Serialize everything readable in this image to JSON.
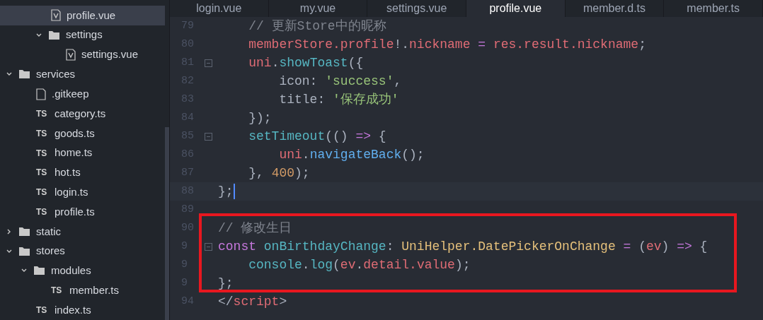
{
  "sidebar": {
    "tree": [
      {
        "children": [
          {
            "kind": "vue",
            "label": "profile.vue",
            "selected": true
          },
          {
            "kind": "folder",
            "label": "settings",
            "expanded": true,
            "selected": false,
            "children": [
              {
                "kind": "vue",
                "label": "settings.vue",
                "selected": false
              }
            ]
          }
        ]
      },
      {
        "kind": "folder",
        "label": "services",
        "expanded": true,
        "selected": false,
        "children": [
          {
            "kind": "blank",
            "label": ".gitkeep",
            "selected": false
          },
          {
            "kind": "ts",
            "icon": "TS",
            "label": "category.ts",
            "selected": false
          },
          {
            "kind": "ts",
            "icon": "TS",
            "label": "goods.ts",
            "selected": false
          },
          {
            "kind": "ts",
            "icon": "TS",
            "label": "home.ts",
            "selected": false
          },
          {
            "kind": "ts",
            "icon": "TS",
            "label": "hot.ts",
            "selected": false
          },
          {
            "kind": "ts",
            "icon": "TS",
            "label": "login.ts",
            "selected": false
          },
          {
            "kind": "ts",
            "icon": "TS",
            "label": "profile.ts",
            "selected": false
          }
        ]
      },
      {
        "kind": "folder",
        "label": "static",
        "expanded": false,
        "selected": false
      },
      {
        "kind": "folder",
        "label": "stores",
        "expanded": true,
        "selected": false,
        "children": [
          {
            "kind": "folder",
            "label": "modules",
            "expanded": true,
            "selected": false,
            "children": [
              {
                "kind": "ts",
                "icon": "TS",
                "label": "member.ts",
                "selected": false
              }
            ]
          },
          {
            "kind": "ts",
            "icon": "TS",
            "label": "index.ts",
            "selected": false
          }
        ]
      }
    ]
  },
  "tabs": [
    {
      "label": "login.vue",
      "selected": false
    },
    {
      "label": "my.vue",
      "selected": false
    },
    {
      "label": "settings.vue",
      "selected": false
    },
    {
      "label": "profile.vue",
      "selected": true
    },
    {
      "label": "member.d.ts",
      "selected": false
    },
    {
      "label": "member.ts",
      "selected": false
    }
  ],
  "editor": {
    "lines": [
      {
        "number": "79",
        "fold": false,
        "current": false,
        "tokens": [
          {
            "text": "    // 更新Store中的昵称",
            "color": "#7f848e"
          }
        ]
      },
      {
        "number": "80",
        "fold": false,
        "current": false,
        "tokens": [
          {
            "text": "    memberStore.profile",
            "color": "#e06c75"
          },
          {
            "text": "!.",
            "color": "#abb2bf"
          },
          {
            "text": "nickname ",
            "color": "#e06c75"
          },
          {
            "text": "= ",
            "color": "#c678dd"
          },
          {
            "text": "res.result.nickname",
            "color": "#e06c75"
          },
          {
            "text": ";",
            "color": "#abb2bf"
          }
        ]
      },
      {
        "number": "81",
        "fold": true,
        "current": false,
        "tokens": [
          {
            "text": "    uni",
            "color": "#e06c75"
          },
          {
            "text": ".",
            "color": "#abb2bf"
          },
          {
            "text": "showToast",
            "color": "#56b6c2"
          },
          {
            "text": "({",
            "color": "#abb2bf"
          }
        ]
      },
      {
        "number": "82",
        "fold": false,
        "current": false,
        "tokens": [
          {
            "text": "        icon: ",
            "color": "#abb2bf"
          },
          {
            "text": "'success'",
            "color": "#98c379"
          },
          {
            "text": ",",
            "color": "#abb2bf"
          }
        ]
      },
      {
        "number": "83",
        "fold": false,
        "current": false,
        "tokens": [
          {
            "text": "        title: ",
            "color": "#abb2bf"
          },
          {
            "text": "'保存成功'",
            "color": "#98c379"
          }
        ]
      },
      {
        "number": "84",
        "fold": false,
        "current": false,
        "tokens": [
          {
            "text": "    });",
            "color": "#abb2bf"
          }
        ]
      },
      {
        "number": "85",
        "fold": true,
        "current": false,
        "tokens": [
          {
            "text": "    setTimeout",
            "color": "#56b6c2"
          },
          {
            "text": "(() ",
            "color": "#abb2bf"
          },
          {
            "text": "=>",
            "color": "#c678dd"
          },
          {
            "text": " {",
            "color": "#abb2bf"
          }
        ]
      },
      {
        "number": "86",
        "fold": false,
        "current": false,
        "tokens": [
          {
            "text": "        uni",
            "color": "#e06c75"
          },
          {
            "text": ".",
            "color": "#abb2bf"
          },
          {
            "text": "navigateBack",
            "color": "#61afef"
          },
          {
            "text": "();",
            "color": "#abb2bf"
          }
        ]
      },
      {
        "number": "87",
        "fold": false,
        "current": false,
        "tokens": [
          {
            "text": "    }, ",
            "color": "#abb2bf"
          },
          {
            "text": "400",
            "color": "#d19a66"
          },
          {
            "text": ");",
            "color": "#abb2bf"
          }
        ]
      },
      {
        "number": "88",
        "fold": false,
        "current": true,
        "tokens": [
          {
            "text": "};",
            "color": "#abb2bf"
          }
        ]
      },
      {
        "number": "89",
        "fold": false,
        "current": false
      },
      {
        "number": "90",
        "fold": false,
        "current": false,
        "tokens": [
          {
            "text": "// 修改生日",
            "color": "#7f848e"
          }
        ]
      },
      {
        "number": "9",
        "fold": true,
        "current": false,
        "tokens": [
          {
            "text": "const ",
            "color": "#c678dd"
          },
          {
            "text": "onBirthdayChange",
            "color": "#56b6c2"
          },
          {
            "text": ": ",
            "color": "#abb2bf"
          },
          {
            "text": "UniHelper.DatePickerOnChange ",
            "color": "#e5c07b"
          },
          {
            "text": "= ",
            "color": "#c678dd"
          },
          {
            "text": "(",
            "color": "#abb2bf"
          },
          {
            "text": "ev",
            "color": "#e06c75"
          },
          {
            "text": ") ",
            "color": "#abb2bf"
          },
          {
            "text": "=>",
            "color": "#c678dd"
          },
          {
            "text": " {",
            "color": "#abb2bf"
          }
        ]
      },
      {
        "number": "9",
        "fold": false,
        "current": false,
        "tokens": [
          {
            "text": "    console",
            "color": "#56b6c2"
          },
          {
            "text": ".",
            "color": "#abb2bf"
          },
          {
            "text": "log",
            "color": "#56b6c2"
          },
          {
            "text": "(",
            "color": "#abb2bf"
          },
          {
            "text": "ev",
            "color": "#e06c75"
          },
          {
            "text": ".",
            "color": "#abb2bf"
          },
          {
            "text": "detail.value",
            "color": "#e06c75"
          },
          {
            "text": ");",
            "color": "#abb2bf"
          }
        ]
      },
      {
        "number": "9",
        "fold": false,
        "current": false,
        "tokens": [
          {
            "text": "};",
            "color": "#abb2bf"
          }
        ]
      },
      {
        "number": "94",
        "fold": false,
        "current": false,
        "tokens": [
          {
            "text": "</",
            "color": "#abb2bf"
          },
          {
            "text": "script",
            "color": "#e06c75"
          },
          {
            "text": ">",
            "color": "#abb2bf"
          }
        ]
      }
    ]
  }
}
